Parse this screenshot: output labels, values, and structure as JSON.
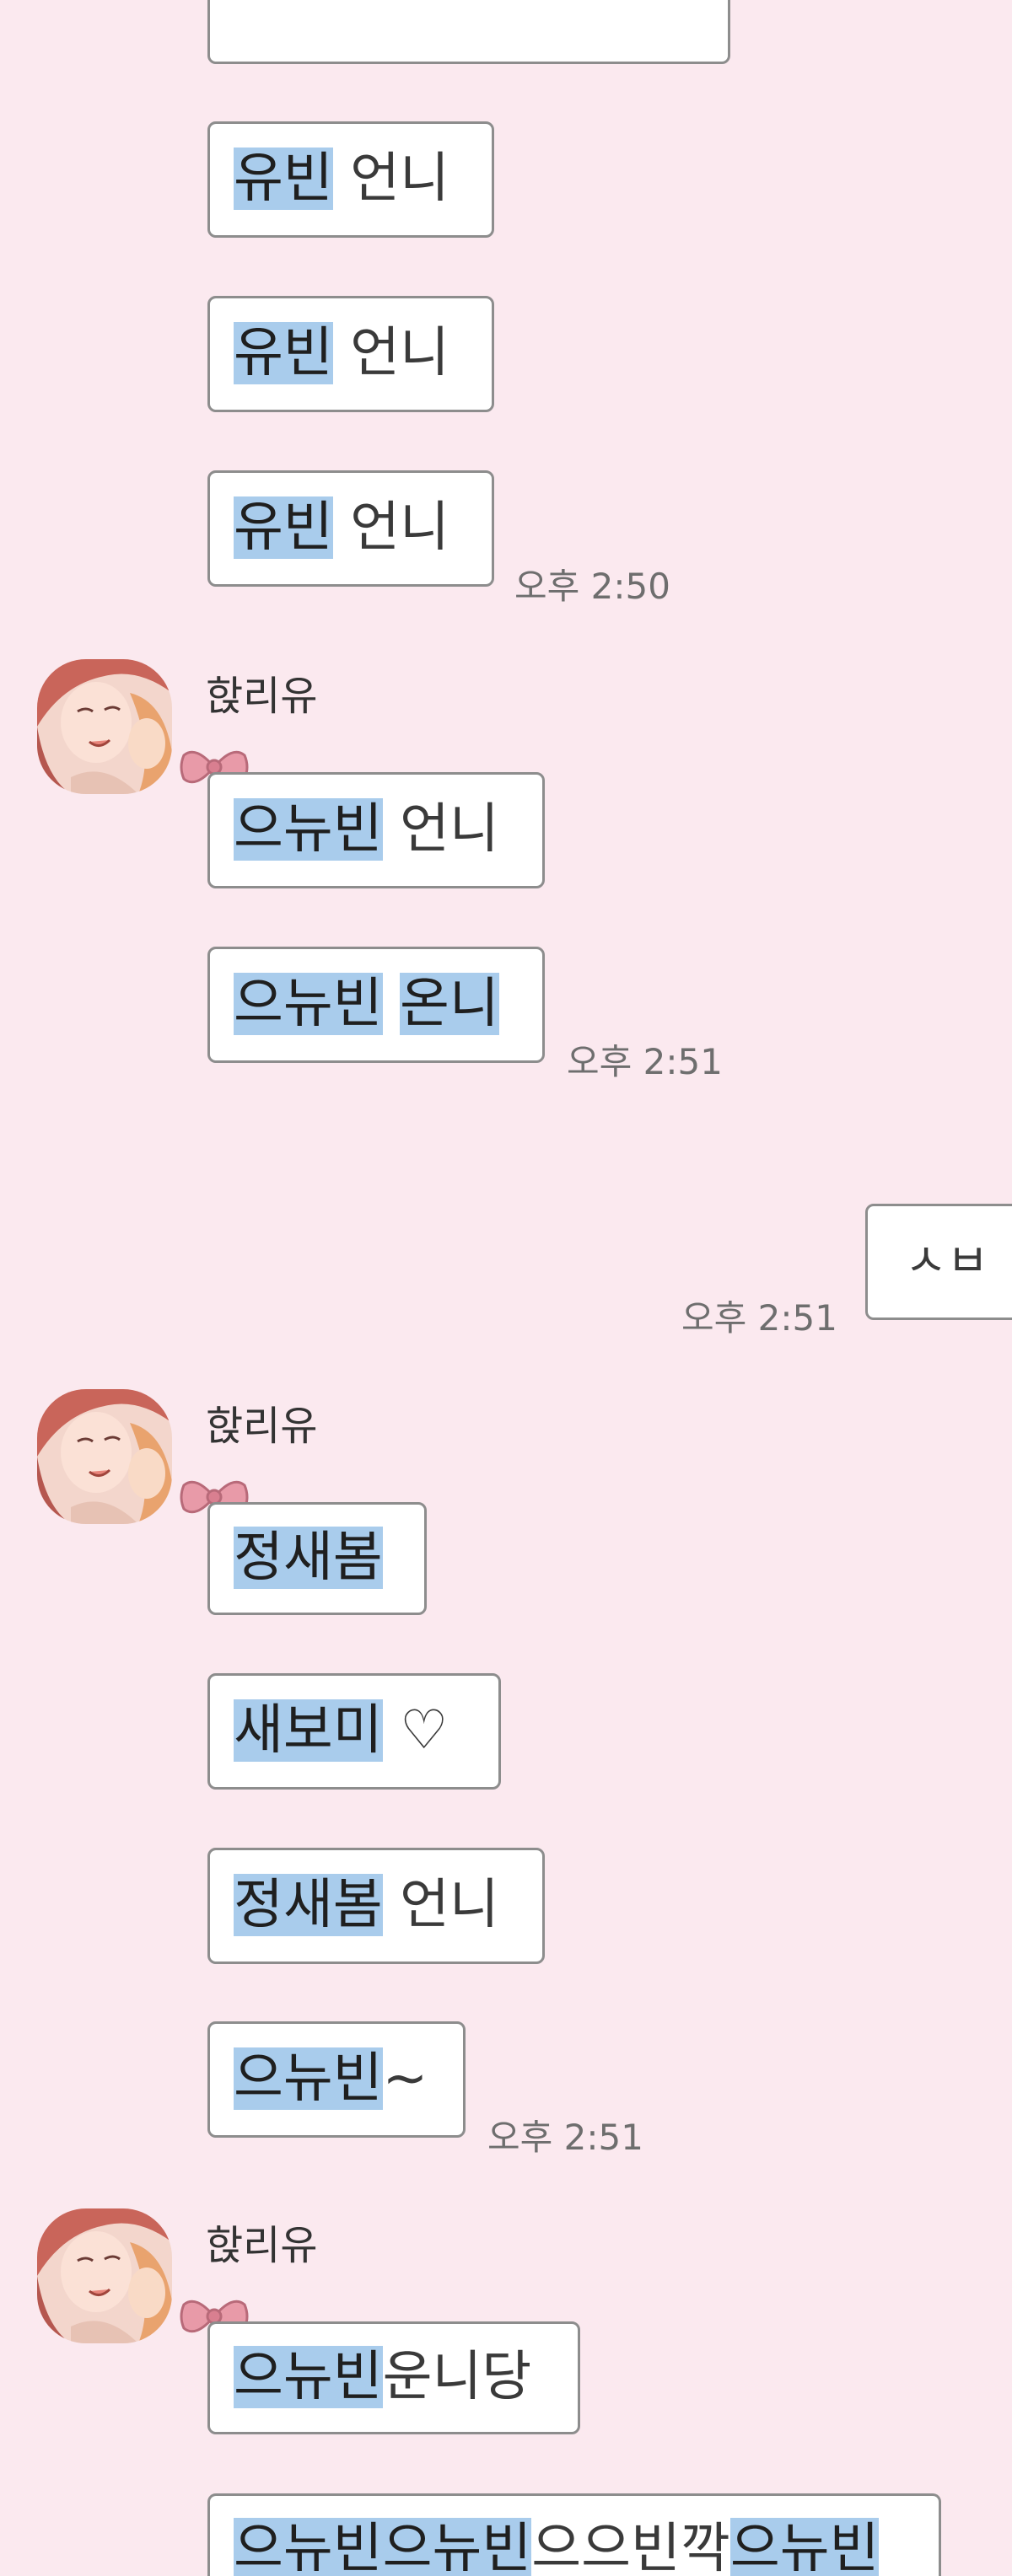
{
  "sender": {
    "name": "핝리유"
  },
  "groups": [
    {
      "id": "g1",
      "side": "received",
      "messages": [
        {
          "highlight": "",
          "text": ""
        },
        {
          "highlight": "유빈",
          "text": " 언니"
        },
        {
          "highlight": "유빈",
          "text": " 언니"
        },
        {
          "highlight": "유빈",
          "text": " 언니"
        }
      ],
      "time": "오후 2:50"
    },
    {
      "id": "g2",
      "side": "received",
      "sender": "핝리유",
      "messages": [
        {
          "highlight": "으뉴빈",
          "text": " 언니"
        },
        {
          "highlight": "으뉴빈",
          "text": " ",
          "highlight2": "온니"
        }
      ],
      "time": "오후 2:51"
    },
    {
      "id": "g3",
      "side": "sent",
      "messages": [
        {
          "text": "ㅅㅂ"
        }
      ],
      "time": "오후 2:51"
    },
    {
      "id": "g4",
      "side": "received",
      "sender": "핝리유",
      "messages": [
        {
          "highlight": "정새봄",
          "text": ""
        },
        {
          "highlight": "새보미",
          "text": " ♡"
        },
        {
          "highlight": "정새봄",
          "text": " 언니"
        },
        {
          "highlight": "으뉴빈",
          "text": "~"
        }
      ],
      "time": "오후 2:51"
    },
    {
      "id": "g5",
      "side": "received",
      "sender": "핝리유",
      "messages": [
        {
          "highlight": "으뉴빈",
          "text": "운니당"
        },
        {
          "highlight": "으뉴빈으뉴빈",
          "text": "으으빈깍",
          "highlight2": "으뉴빈"
        }
      ]
    }
  ],
  "colors": {
    "background": "#fbe9ef",
    "bubble": "#ffffff",
    "bubble_border": "#8d8d8d",
    "highlight": "#a9ccec",
    "time_text": "#6e6e6e"
  }
}
